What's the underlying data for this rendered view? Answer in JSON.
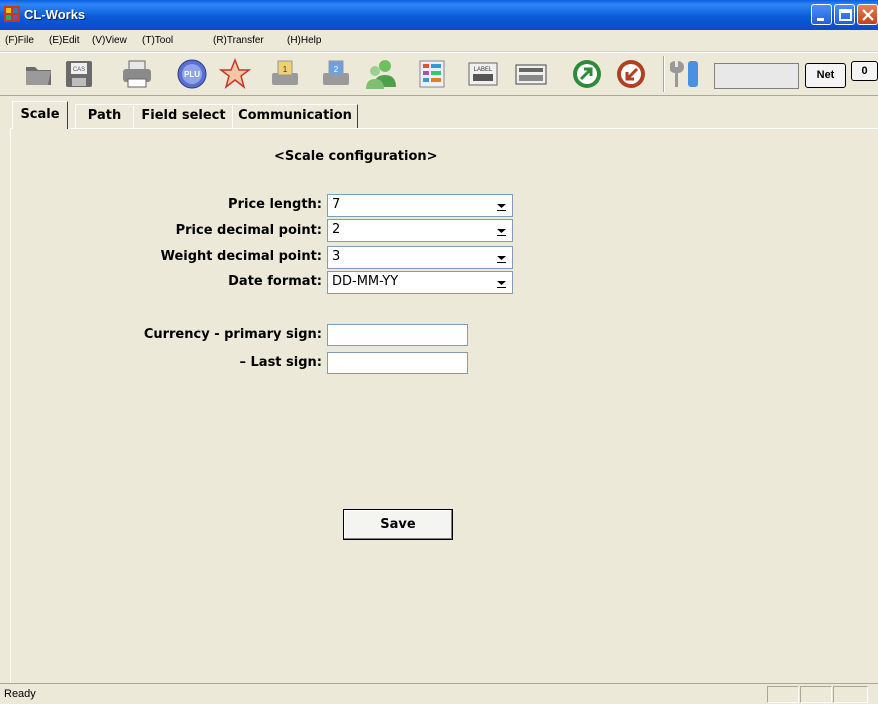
{
  "window": {
    "title": "CL-Works"
  },
  "menu": [
    "(F)File",
    "(E)Edit",
    "(V)View",
    "(T)Tool",
    "(R)Transfer",
    "(H)Help"
  ],
  "toolbar": {
    "icons": [
      "open-folder-icon",
      "save-disk-icon",
      "printer-icon",
      "plu-icon",
      "star-icon",
      "download-icon",
      "upload-icon",
      "users-icon",
      "color-grid-icon",
      "label-icon",
      "keyboard-icon",
      "forward-arrow-icon",
      "back-arrow-icon",
      "tools-icon"
    ],
    "plu_text": "PLU",
    "label_text": "LABEL",
    "cas_text": "CAS",
    "net_label": "Net",
    "zero_label": "0",
    "display_value": ""
  },
  "tabs": [
    "Scale",
    "Path",
    "Field select",
    "Communication"
  ],
  "active_tab": "Scale",
  "panel": {
    "title": "<Scale configuration>",
    "fields": {
      "price_length": {
        "label": "Price length:",
        "value": "7"
      },
      "price_decimal": {
        "label": "Price decimal point:",
        "value": "2"
      },
      "weight_decimal": {
        "label": "Weight decimal point:",
        "value": "3"
      },
      "date_format": {
        "label": "Date format:",
        "value": "DD-MM-YY"
      },
      "currency_primary": {
        "label": "Currency - primary sign:",
        "value": ""
      },
      "last_sign": {
        "label": "– Last sign:",
        "value": ""
      }
    },
    "save_label": "Save"
  },
  "status": {
    "text": "Ready"
  },
  "colors": {
    "titlebar": "#0a5fe0",
    "face": "#ece9d8",
    "field_border": "#7f9db9"
  }
}
